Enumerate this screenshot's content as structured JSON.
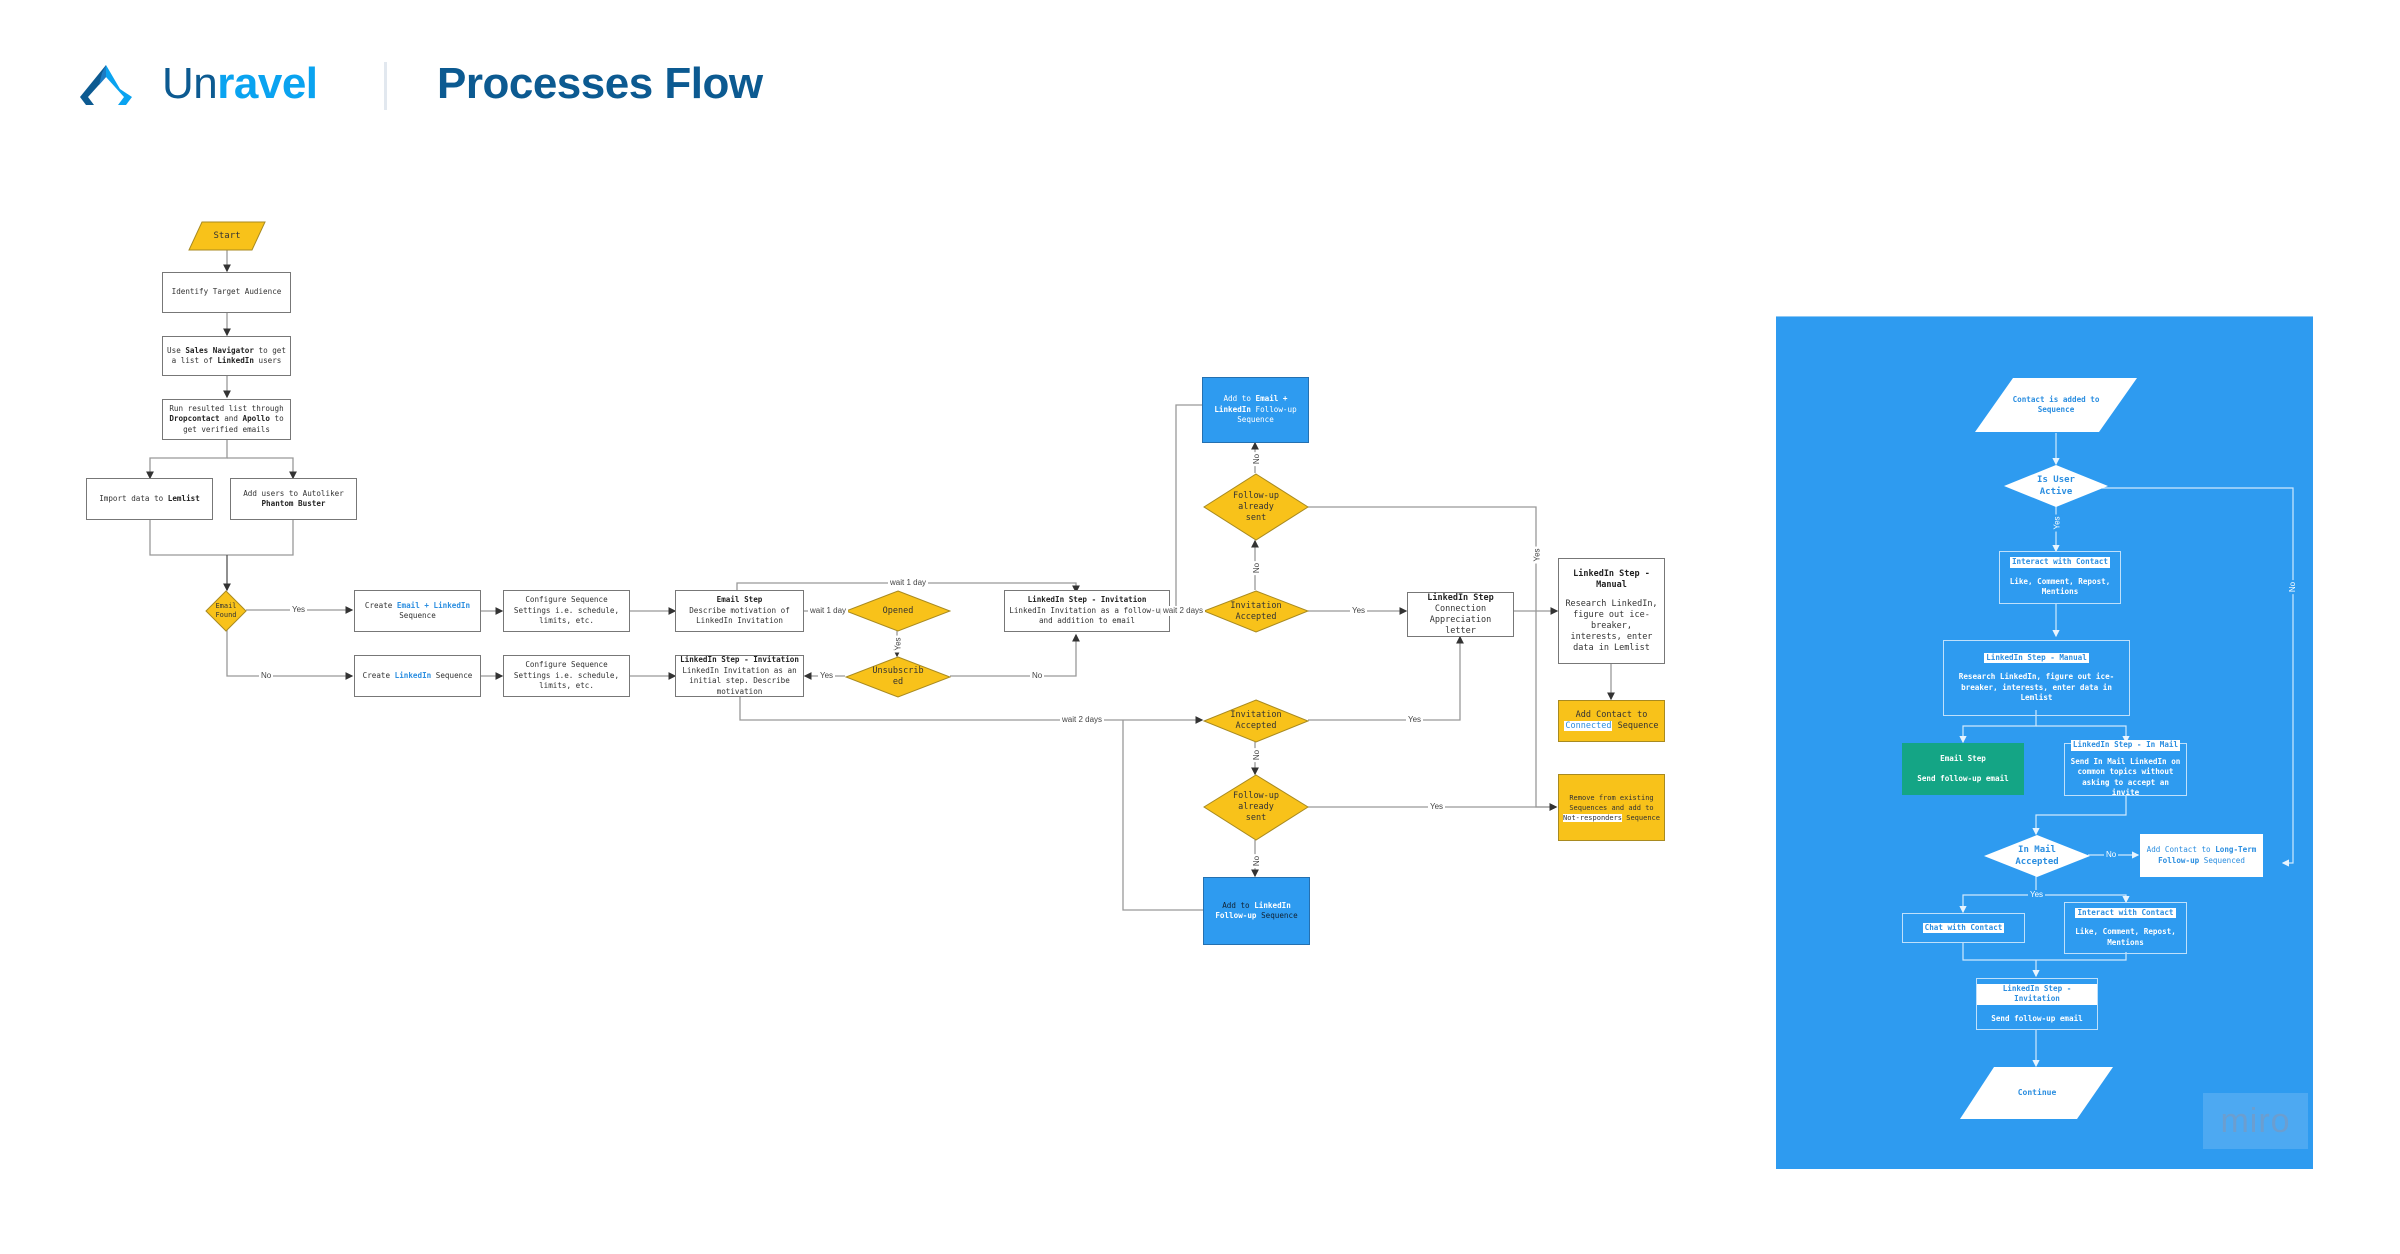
{
  "header": {
    "brand_part1": "Un",
    "brand_part2": "ravel",
    "title": "Processes Flow",
    "logo_icon": "unravel-logo-icon"
  },
  "colors": {
    "brand_dark": "#0c5a91",
    "brand_light": "#0aa3f0",
    "decision_yellow": "#f8c21a",
    "action_blue": "#2e9bf0",
    "email_green": "#14a585"
  },
  "main_flow": {
    "start": "Start",
    "identify": "Identify Target Audience",
    "sales_nav": {
      "pre": "Use ",
      "b1": "Sales Navigator",
      "mid": " to get a list of ",
      "b2": "LinkedIn",
      "post": " users"
    },
    "run_list": {
      "pre": "Run resulted list through ",
      "b1": "Dropcontact",
      "mid": " and ",
      "b2": "Apollo",
      "post": " to get verified emails"
    },
    "import": {
      "pre": "Import data to ",
      "b1": "Lemlist"
    },
    "autoliker": {
      "pre": "Add users to Autoliker ",
      "b1": "Phantom Buster"
    },
    "email_found": "Email Found",
    "create_email_linkedin": {
      "pre": "Create ",
      "hl": "Email + LinkedIn",
      "post": " Sequence"
    },
    "create_linkedin": {
      "pre": "Create ",
      "hl": "LinkedIn",
      "post": " Sequence"
    },
    "configure_1": "Configure Sequence Settings i.e. schedule, limits, etc.",
    "configure_2": "Configure Sequence Settings i.e. schedule, limits, etc.",
    "email_step": {
      "title": "Email Step",
      "body": "Describe motivation of LinkedIn Invitation"
    },
    "linkedin_invite_initial": {
      "title": "LinkedIn Step - Invitation",
      "body": "LinkedIn Invitation as an initial step. Describe motivation"
    },
    "opened": "Opened",
    "unsubscribed": "Unsubscribed",
    "linkedin_invite_followup": {
      "title": "LinkedIn Step - Invitation",
      "body": "LinkedIn Invitation as a follow-up and addition to email"
    },
    "invitation_accepted_top": "Invitation Accepted",
    "followup_sent_top": "Follow-up already sent",
    "add_email_linkedin_followup": {
      "pre": "Add to ",
      "hl": "Email + LinkedIn",
      "post": " Follow-up Sequence"
    },
    "connection_step": {
      "title": "LinkedIn Step",
      "body": "Connection Appreciation letter"
    },
    "manual_step": {
      "title": "LinkedIn Step - Manual",
      "body": "Research LinkedIn, figure out ice-breaker, interests, enter data in Lemlist"
    },
    "add_connected": {
      "pre": "Add Contact to ",
      "hl": "Connected",
      "post": " Sequence"
    },
    "invitation_accepted_bottom": "Invitation Accepted",
    "followup_sent_bottom": "Follow-up already sent",
    "add_linkedin_followup": {
      "pre": "Add to ",
      "hl": "LinkedIn Follow-up",
      "post": " Sequence"
    },
    "remove_existing": {
      "pre": "Remove from existing Sequences and add to ",
      "hl": "Not-responders",
      "post": " Sequence"
    }
  },
  "edge_labels": {
    "yes": "Yes",
    "no": "No",
    "wait_1_day": "wait 1 day",
    "wait_2_days": "wait 2 days"
  },
  "side_panel": {
    "start": "Contact is added to Sequence",
    "is_user_active": "Is User Active",
    "interact_1": {
      "title": "Interact with Contact",
      "body": "Like, Comment, Repost, Mentions"
    },
    "manual": {
      "title": "LinkedIn Step - Manual",
      "body": "Research LinkedIn, figure out ice-breaker, interests, enter data in Lemlist"
    },
    "email_step": {
      "title": "Email Step",
      "body": "Send follow-up email"
    },
    "inmail_step": {
      "title": "LinkedIn Step - In Mail",
      "body": "Send In Mail LinkedIn on common topics without asking to accept an invite"
    },
    "inmail_accepted": "In Mail Accepted",
    "long_term": {
      "pre": "Add Contact to ",
      "b1": "Long-Term Follow-up",
      "post": " Sequenced"
    },
    "chat": {
      "title": "Chat with Contact"
    },
    "interact_2": {
      "title": "Interact with Contact",
      "body": "Like, Comment, Repost, Mentions"
    },
    "invite_step": {
      "title": "LinkedIn Step - Invitation",
      "body": "Send follow-up email"
    },
    "continue": "Continue"
  },
  "watermark": "miro"
}
